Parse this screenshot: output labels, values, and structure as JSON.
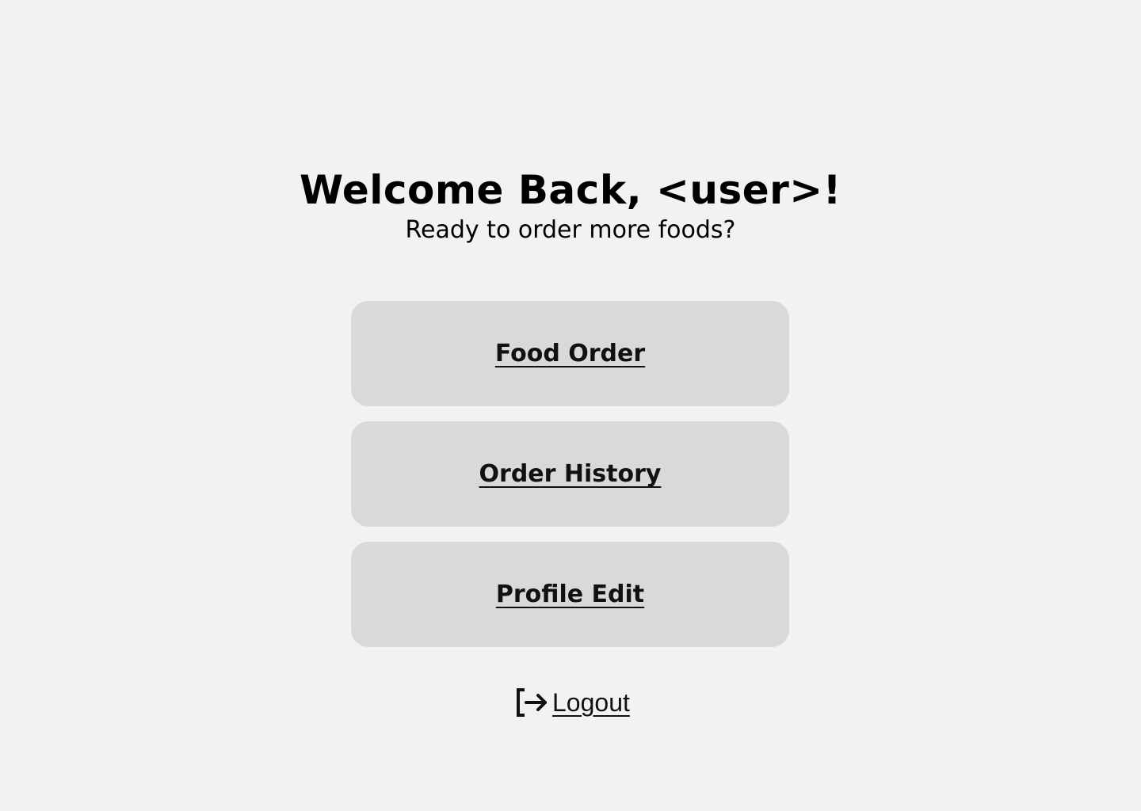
{
  "header": {
    "title": "Welcome Back, <user>!",
    "subtitle": "Ready to order more foods?"
  },
  "menu": {
    "items": [
      {
        "label": "Food Order"
      },
      {
        "label": "Order History"
      },
      {
        "label": "Profile Edit"
      }
    ]
  },
  "logout": {
    "icon": "logout-icon",
    "label": "Logout"
  },
  "colors": {
    "background": "#f3f2f0",
    "button": "#d9d9d9",
    "text": "#000000"
  }
}
